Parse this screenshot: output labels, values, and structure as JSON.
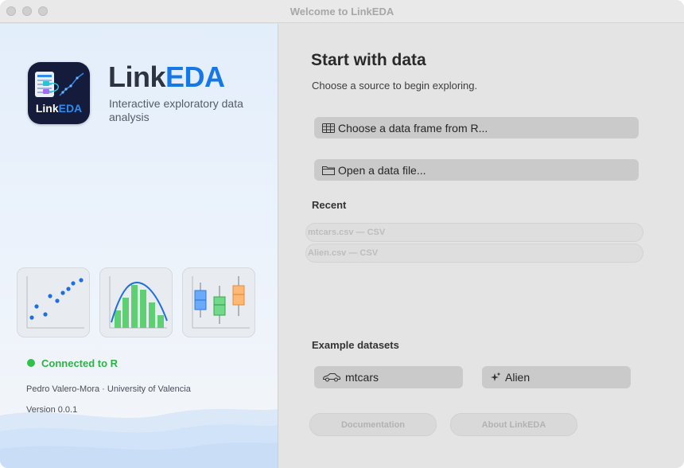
{
  "window": {
    "title": "Welcome to LinkEDA"
  },
  "brand": {
    "name_prefix": "Link",
    "name_accent": "EDA",
    "tagline": "Interactive exploratory data analysis",
    "icon_label_prefix": "Link",
    "icon_label_accent": "EDA",
    "accent_color": "#1678e8"
  },
  "thumbnails": [
    {
      "name": "scatter-plot-icon"
    },
    {
      "name": "histogram-icon"
    },
    {
      "name": "boxplot-icon"
    }
  ],
  "status": {
    "text": "Connected to R",
    "color": "#2bb446"
  },
  "credit": "Pedro Valero-Mora · University of Valencia",
  "version": "Version 0.0.1",
  "main": {
    "heading": "Start with data",
    "subheading": "Choose a source to begin exploring.",
    "choose_frame_label": "Choose a data frame from R...",
    "open_file_label": "Open a data file..."
  },
  "recent": {
    "label": "Recent",
    "items": [
      {
        "text": "mtcars.csv  —  CSV"
      },
      {
        "text": "Alien.csv  —  CSV"
      }
    ]
  },
  "examples": {
    "label": "Example datasets",
    "items": [
      {
        "label": "mtcars",
        "icon": "car-icon"
      },
      {
        "label": "Alien",
        "icon": "sparkles-icon"
      }
    ]
  },
  "footer": {
    "documentation_label": "Documentation",
    "about_label": "About LinkEDA"
  }
}
